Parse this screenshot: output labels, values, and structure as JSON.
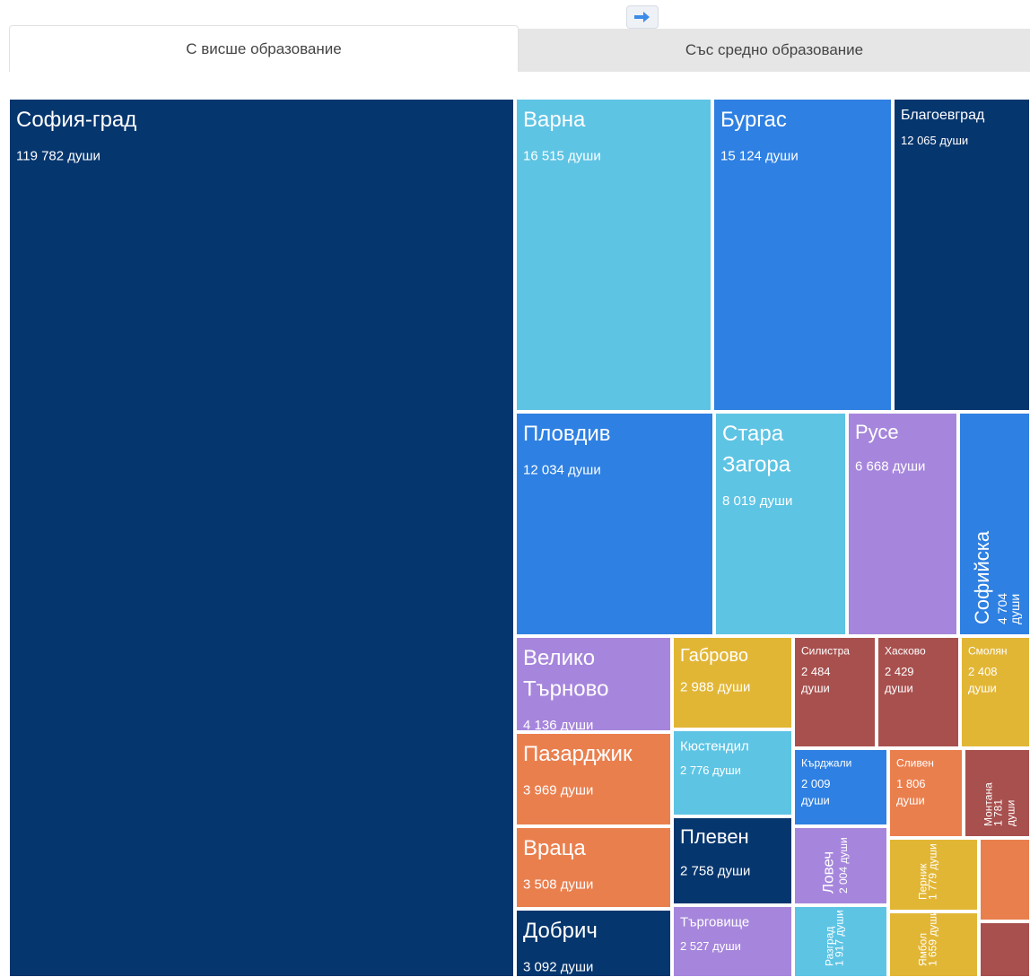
{
  "tabs": [
    {
      "label": "С висше образование",
      "active": true
    },
    {
      "label": "Със средно образование",
      "active": false
    }
  ],
  "tab_icon": "export-icon",
  "chart_data": {
    "type": "treemap",
    "unit": "души",
    "items": [
      {
        "name": "София-град",
        "value": 119782,
        "value_label": "119 782 души",
        "color": "#06366E"
      },
      {
        "name": "Варна",
        "value": 16515,
        "value_label": "16 515 души",
        "color": "#5EC4E4"
      },
      {
        "name": "Бургас",
        "value": 15124,
        "value_label": "15 124 души",
        "color": "#2E80E2"
      },
      {
        "name": "Благоевград",
        "value": 12065,
        "value_label": "12 065 души",
        "color": "#06366E"
      },
      {
        "name": "Пловдив",
        "value": 12034,
        "value_label": "12 034 души",
        "color": "#2E80E2"
      },
      {
        "name": "Стара Загора",
        "value": 8019,
        "value_label": "8 019 души",
        "color": "#5EC4E4"
      },
      {
        "name": "Русе",
        "value": 6668,
        "value_label": "6 668 души",
        "color": "#A686DC"
      },
      {
        "name": "Софийска",
        "value": 4704,
        "value_label": "4 704 души",
        "color": "#2E80E2"
      },
      {
        "name": "Велико Търново",
        "value": 4136,
        "value_label": "4 136 души",
        "color": "#A686DC"
      },
      {
        "name": "Габрово",
        "value": 2988,
        "value_label": "2 988 души",
        "color": "#E2B635"
      },
      {
        "name": "Силистра",
        "value": 2484,
        "value_label": "2 484 души",
        "color": "#A8504E"
      },
      {
        "name": "Хасково",
        "value": 2429,
        "value_label": "2 429 души",
        "color": "#A8504E"
      },
      {
        "name": "Смолян",
        "value": 2408,
        "value_label": "2 408 души",
        "color": "#E2B635"
      },
      {
        "name": "Пазарджик",
        "value": 3969,
        "value_label": "3 969 души",
        "color": "#EA7F4E"
      },
      {
        "name": "Кюстендил",
        "value": 2776,
        "value_label": "2 776 души",
        "color": "#5EC4E4"
      },
      {
        "name": "Кърджали",
        "value": 2009,
        "value_label": "2 009 души",
        "color": "#2E80E2"
      },
      {
        "name": "Сливен",
        "value": 1806,
        "value_label": "1 806 души",
        "color": "#EA7F4E"
      },
      {
        "name": "Монтана",
        "value": 1781,
        "value_label": "1 781 души",
        "color": "#A8504E"
      },
      {
        "name": "Враца",
        "value": 3508,
        "value_label": "3 508 души",
        "color": "#EA7F4E"
      },
      {
        "name": "Плевен",
        "value": 2758,
        "value_label": "2 758 души",
        "color": "#06366E"
      },
      {
        "name": "Ловеч",
        "value": 2004,
        "value_label": "2 004 души",
        "color": "#A686DC"
      },
      {
        "name": "Перник",
        "value": 1779,
        "value_label": "1 779 души",
        "color": "#E2B635"
      },
      {
        "name": "Добрич",
        "value": 3092,
        "value_label": "3 092 души",
        "color": "#06366E"
      },
      {
        "name": "Търговище",
        "value": 2527,
        "value_label": "2 527 души",
        "color": "#A686DC"
      },
      {
        "name": "Разград",
        "value": 1917,
        "value_label": "1 917 души",
        "color": "#5EC4E4"
      },
      {
        "name": "Ямбол",
        "value": 1659,
        "value_label": "1 659 души",
        "color": "#E2B635"
      }
    ]
  }
}
